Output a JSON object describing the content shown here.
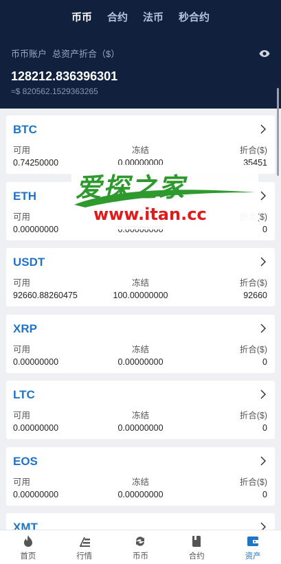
{
  "tabs": [
    {
      "label": "币币",
      "active": true
    },
    {
      "label": "合约",
      "active": false
    },
    {
      "label": "法币",
      "active": false
    },
    {
      "label": "秒合约",
      "active": false
    }
  ],
  "account": {
    "title": "币币账户",
    "subtitle": "总资产折合（$）",
    "total": "128212.836396301",
    "total_usd": "≈$ 820562.1529363265"
  },
  "columns": {
    "available": "可用",
    "frozen": "冻结",
    "converted": "折合($)"
  },
  "assets": [
    {
      "coin": "BTC",
      "available": "0.74250000",
      "frozen": "0.00000000",
      "converted": "35451"
    },
    {
      "coin": "ETH",
      "available": "0.00000000",
      "frozen": "0.00000000",
      "converted": "0"
    },
    {
      "coin": "USDT",
      "available": "92660.88260475",
      "frozen": "100.00000000",
      "converted": "92660"
    },
    {
      "coin": "XRP",
      "available": "0.00000000",
      "frozen": "0.00000000",
      "converted": "0"
    },
    {
      "coin": "LTC",
      "available": "0.00000000",
      "frozen": "0.00000000",
      "converted": "0"
    },
    {
      "coin": "EOS",
      "available": "0.00000000",
      "frozen": "0.00000000",
      "converted": "0"
    },
    {
      "coin": "XMT",
      "available": "",
      "frozen": "",
      "converted": ""
    }
  ],
  "watermark": {
    "title": "爱探之家",
    "url": "www.itan.cc"
  },
  "bottom_nav": [
    {
      "label": "首页",
      "icon": "flame-icon",
      "active": false
    },
    {
      "label": "行情",
      "icon": "market-icon",
      "active": false
    },
    {
      "label": "币币",
      "icon": "exchange-icon",
      "active": false
    },
    {
      "label": "合约",
      "icon": "contract-icon",
      "active": false
    },
    {
      "label": "资产",
      "icon": "wallet-icon",
      "active": true
    }
  ],
  "colors": {
    "header": "#11213d",
    "accent": "#1f74c7",
    "watermark_green": "#2e9a2e",
    "watermark_red": "#e01b1b"
  }
}
